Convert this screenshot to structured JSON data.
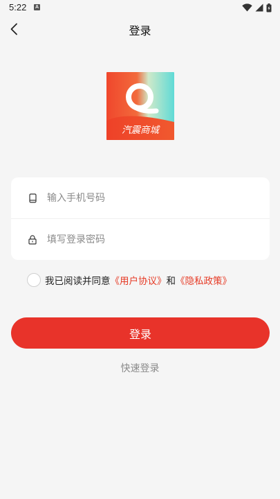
{
  "status_bar": {
    "time": "5:22",
    "notification_icon": "a-notification-icon",
    "icons": [
      "wifi-icon",
      "signal-icon",
      "battery-icon"
    ]
  },
  "nav": {
    "back_icon": "chevron-left-icon",
    "title": "登录"
  },
  "logo": {
    "text": "汽震商城",
    "colors": {
      "left": "#f24a2a",
      "right": "#5fd9d4",
      "band": "#e8402a"
    }
  },
  "form": {
    "phone": {
      "icon": "phone-icon",
      "value": "",
      "placeholder": "输入手机号码"
    },
    "password": {
      "icon": "lock-icon",
      "value": "",
      "placeholder": "填写登录密码"
    }
  },
  "agreement": {
    "checked": false,
    "prefix": "我已阅读并同意",
    "user_agreement": "《用户协议》",
    "and": "和",
    "privacy_policy": "《隐私政策》"
  },
  "actions": {
    "login_label": "登录",
    "quick_login_label": "快速登录"
  },
  "colors": {
    "accent": "#e8332a",
    "link": "#e63b26",
    "background": "#f5f5f5"
  }
}
